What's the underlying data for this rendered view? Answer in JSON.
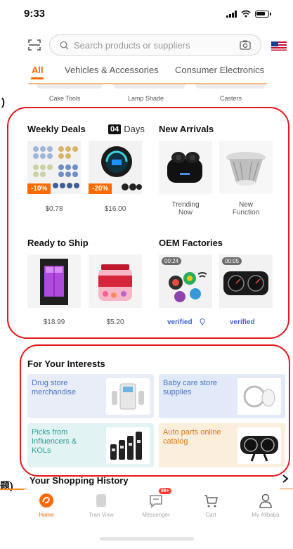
{
  "status_bar": {
    "time": "9:33"
  },
  "search": {
    "placeholder": "Search products or suppliers"
  },
  "category_tabs": [
    {
      "label": "All",
      "active": true
    },
    {
      "label": "Vehicles & Accessories",
      "active": false
    },
    {
      "label": "Consumer Electronics",
      "active": false
    }
  ],
  "subcategories": [
    "Cake Tools",
    "Lamp Shade",
    "Casters"
  ],
  "left_edge_text": ")",
  "weekly_deals": {
    "title": "Weekly Deals",
    "days_count": "04",
    "days_label": "Days",
    "items": [
      {
        "discount": "-10%",
        "price": "$0.78"
      },
      {
        "discount": "-20%",
        "price": "$16.00"
      }
    ]
  },
  "new_arrivals": {
    "title": "New Arrivals",
    "items": [
      {
        "caption_line1": "Trending",
        "caption_line2": "Now"
      },
      {
        "caption_line1": "New",
        "caption_line2": "Function"
      }
    ]
  },
  "ready_to_ship": {
    "title": "Ready to Ship",
    "items": [
      {
        "price": "$18.99"
      },
      {
        "price": "$5.20"
      }
    ]
  },
  "oem_factories": {
    "title": "OEM Factories",
    "items": [
      {
        "video_duration": "00:24",
        "verified_label": "verified"
      },
      {
        "video_duration": "00:05",
        "verified_label": "verified"
      }
    ]
  },
  "interests": {
    "title": "For Your Interests",
    "cards": [
      {
        "label": "Drug store merchandise",
        "bg": "#e8edf7",
        "text_color": "#4a76c8"
      },
      {
        "label": "Baby care store supplies",
        "bg": "#e2e9f8",
        "text_color": "#4a76c8"
      },
      {
        "label": "Picks from Influencers & KOLs",
        "bg": "#e1f3f2",
        "text_color": "#2e9d96"
      },
      {
        "label": "Auto parts online catalog",
        "bg": "#fbeedd",
        "text_color": "#d47a1c"
      }
    ]
  },
  "history": {
    "title": "Your Shopping History",
    "left_glyph": "题)"
  },
  "tab_bar": {
    "items": [
      {
        "label": "Home",
        "icon": "home-icon",
        "active": true
      },
      {
        "label": "Tran View",
        "icon": "tran-view-icon",
        "active": false
      },
      {
        "label": "Messenger",
        "icon": "messenger-icon",
        "active": false,
        "badge": "99+"
      },
      {
        "label": "Cart",
        "icon": "cart-icon",
        "active": false
      },
      {
        "label": "My Alibaba",
        "icon": "person-icon",
        "active": false
      }
    ]
  },
  "colors": {
    "accent": "#ff6a00",
    "annotation": "#e8151b",
    "verified": "#3a66c4"
  }
}
